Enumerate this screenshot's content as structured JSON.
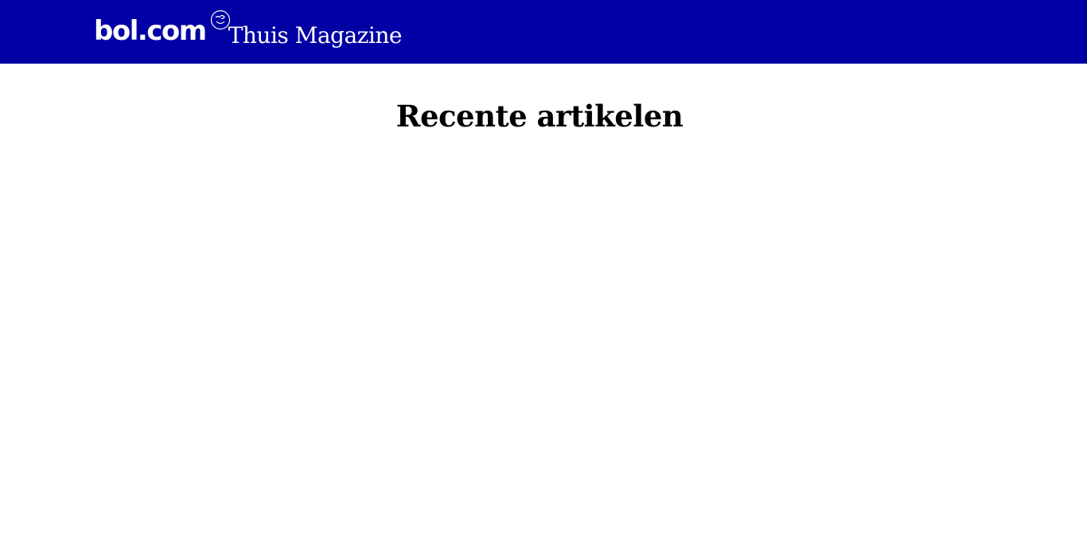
{
  "header": {
    "logo_text": "bol.com",
    "magazine_title": "Thuis Magazine",
    "background_color": "#0000a4"
  },
  "main": {
    "title": "Recente artikelen"
  }
}
